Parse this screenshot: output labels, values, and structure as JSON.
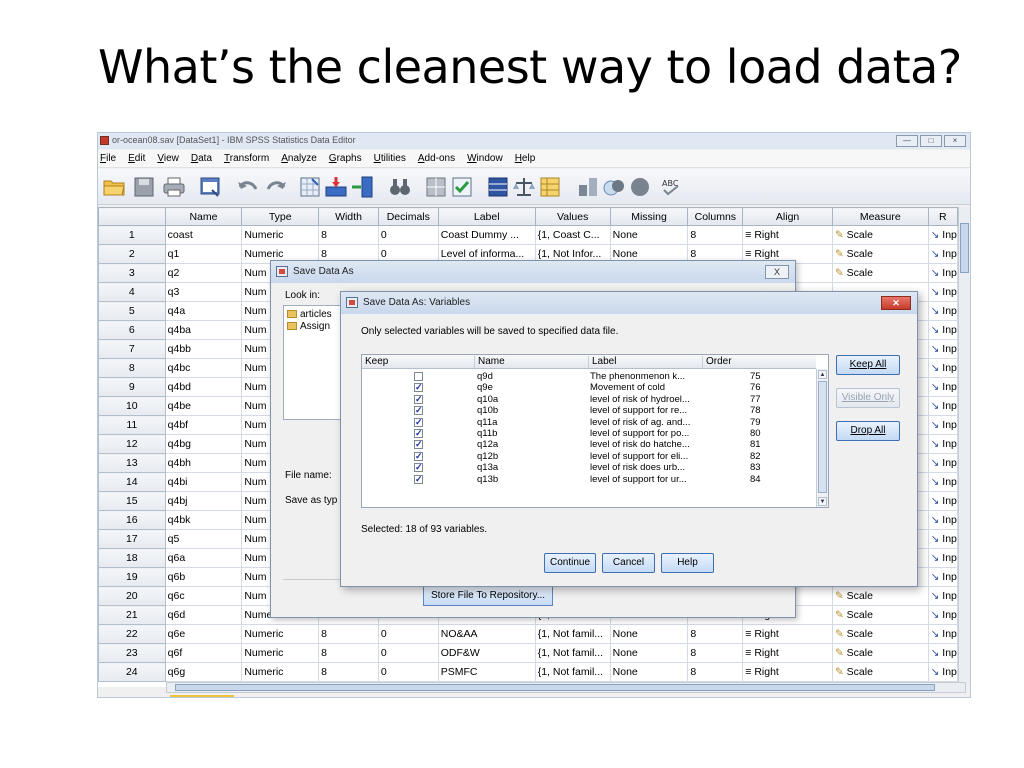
{
  "slide": {
    "title": "What’s the cleanest way to load data?"
  },
  "window": {
    "title": "or-ocean08.sav [DataSet1] - IBM SPSS Statistics Data Editor",
    "menu": [
      "File",
      "Edit",
      "View",
      "Data",
      "Transform",
      "Analyze",
      "Graphs",
      "Utilities",
      "Add-ons",
      "Window",
      "Help"
    ]
  },
  "grid": {
    "columns": [
      "",
      "Name",
      "Type",
      "Width",
      "Decimals",
      "Label",
      "Values",
      "Missing",
      "Columns",
      "Align",
      "Measure",
      "R"
    ],
    "rows": [
      [
        "1",
        "coast",
        "Numeric",
        "8",
        "0",
        "Coast Dummy ...",
        "{1, Coast C...",
        "None",
        "8",
        "Right",
        "Scale",
        "Inp"
      ],
      [
        "2",
        "q1",
        "Numeric",
        "8",
        "0",
        "Level of informa...",
        "{1, Not Infor...",
        "None",
        "8",
        "Right",
        "Scale",
        "Inp"
      ],
      [
        "3",
        "q2",
        "Num",
        "",
        "",
        "",
        "",
        "",
        "",
        "",
        "Scale",
        "Inp"
      ],
      [
        "4",
        "q3",
        "Num",
        "",
        "",
        "",
        "",
        "",
        "",
        "",
        "",
        "Inp"
      ],
      [
        "5",
        "q4a",
        "Num",
        "",
        "",
        "",
        "",
        "",
        "",
        "",
        "",
        "Inp"
      ],
      [
        "6",
        "q4ba",
        "Num",
        "",
        "",
        "",
        "",
        "",
        "",
        "",
        "",
        "Inp"
      ],
      [
        "7",
        "q4bb",
        "Num",
        "",
        "",
        "",
        "",
        "",
        "",
        "",
        "",
        "Inp"
      ],
      [
        "8",
        "q4bc",
        "Num",
        "",
        "",
        "",
        "",
        "",
        "",
        "",
        "",
        "Inp"
      ],
      [
        "9",
        "q4bd",
        "Num",
        "",
        "",
        "",
        "",
        "",
        "",
        "",
        "",
        "Inp"
      ],
      [
        "10",
        "q4be",
        "Num",
        "",
        "",
        "",
        "",
        "",
        "",
        "",
        "",
        "Inp"
      ],
      [
        "11",
        "q4bf",
        "Num",
        "",
        "",
        "",
        "",
        "",
        "",
        "",
        "",
        "Inp"
      ],
      [
        "12",
        "q4bg",
        "Num",
        "",
        "",
        "",
        "",
        "",
        "",
        "",
        "",
        "Inp"
      ],
      [
        "13",
        "q4bh",
        "Num",
        "",
        "",
        "",
        "",
        "",
        "",
        "",
        "",
        "Inp"
      ],
      [
        "14",
        "q4bi",
        "Num",
        "",
        "",
        "",
        "",
        "",
        "",
        "",
        "",
        "Inp"
      ],
      [
        "15",
        "q4bj",
        "Num",
        "",
        "",
        "",
        "",
        "",
        "",
        "",
        "",
        "Inp"
      ],
      [
        "16",
        "q4bk",
        "Num",
        "",
        "",
        "",
        "",
        "",
        "",
        "",
        "",
        "Inp"
      ],
      [
        "17",
        "q5",
        "Num",
        "",
        "",
        "",
        "",
        "",
        "",
        "",
        "",
        "Inp"
      ],
      [
        "18",
        "q6a",
        "Num",
        "",
        "",
        "",
        "",
        "",
        "",
        "",
        "",
        "Inp"
      ],
      [
        "19",
        "q6b",
        "Num",
        "",
        "",
        "",
        "",
        "",
        "",
        "",
        "",
        "Inp"
      ],
      [
        "20",
        "q6c",
        "Num",
        "",
        "",
        "",
        "",
        "",
        "",
        "",
        "Scale",
        "Inp"
      ],
      [
        "21",
        "q6d",
        "Numeric",
        "",
        "",
        "",
        "{1, Not famil...",
        "None",
        "",
        "Right",
        "Scale",
        "Inp"
      ],
      [
        "22",
        "q6e",
        "Numeric",
        "8",
        "0",
        "NO&AA",
        "{1, Not famil...",
        "None",
        "8",
        "Right",
        "Scale",
        "Inp"
      ],
      [
        "23",
        "q6f",
        "Numeric",
        "8",
        "0",
        "ODF&W",
        "{1, Not famil...",
        "None",
        "8",
        "Right",
        "Scale",
        "Inp"
      ],
      [
        "24",
        "q6g",
        "Numeric",
        "8",
        "0",
        "PSMFC",
        "{1, Not famil...",
        "None",
        "8",
        "Right",
        "Scale",
        "Inp"
      ]
    ]
  },
  "save_as": {
    "title": "Save Data As",
    "look_in_label": "Look in:",
    "files": [
      "articles",
      "Assign"
    ],
    "file_name_label": "File name:",
    "save_as_type_label": "Save as typ",
    "repo_button": "Store File To Repository...",
    "close": "X"
  },
  "variables": {
    "title": "Save Data As: Variables",
    "info": "Only selected variables will be saved to specified data file.",
    "headers": [
      "Keep",
      "Name",
      "Label",
      "Order"
    ],
    "rows": [
      {
        "keep": false,
        "name": "q9d",
        "label": "The phenonmenon k...",
        "order": "75"
      },
      {
        "keep": true,
        "name": "q9e",
        "label": "Movement of cold",
        "order": "76"
      },
      {
        "keep": true,
        "name": "q10a",
        "label": "level of risk of hydroel...",
        "order": "77"
      },
      {
        "keep": true,
        "name": "q10b",
        "label": "level of support for re...",
        "order": "78"
      },
      {
        "keep": true,
        "name": "q11a",
        "label": "level of risk of ag. and...",
        "order": "79"
      },
      {
        "keep": true,
        "name": "q11b",
        "label": "level of support for po...",
        "order": "80"
      },
      {
        "keep": true,
        "name": "q12a",
        "label": "level of risk do hatche...",
        "order": "81"
      },
      {
        "keep": true,
        "name": "q12b",
        "label": "level of support for eli...",
        "order": "82"
      },
      {
        "keep": true,
        "name": "q13a",
        "label": "level of risk does urb...",
        "order": "83"
      },
      {
        "keep": true,
        "name": "q13b",
        "label": "level of support for ur...",
        "order": "84"
      }
    ],
    "selected": "Selected: 18 of 93 variables.",
    "buttons": {
      "keep_all": "Keep All",
      "visible_only": "Visible Only",
      "drop_all": "Drop All",
      "continue": "Continue",
      "cancel": "Cancel",
      "help": "Help"
    }
  }
}
